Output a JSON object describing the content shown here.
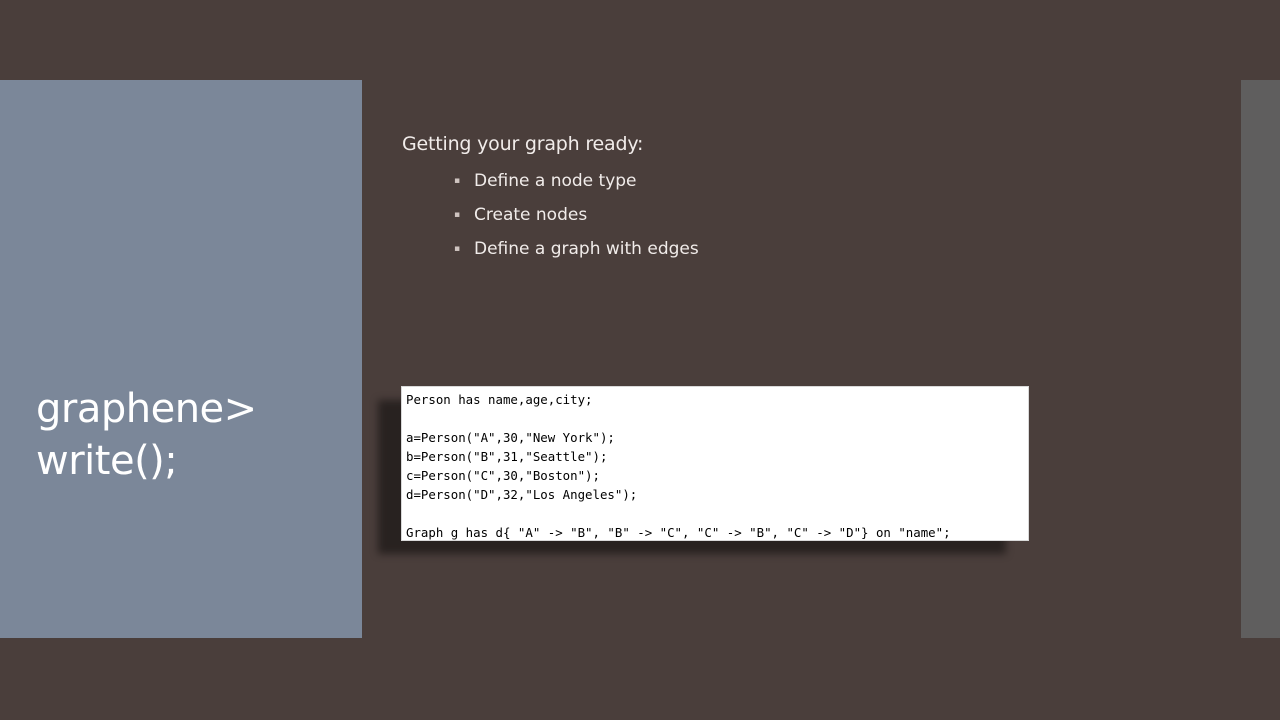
{
  "slide": {
    "title": "graphene>\nwrite();",
    "intro": "Getting your graph ready:",
    "bullets": [
      "Define a node type",
      "Create nodes",
      "Define a graph with edges"
    ],
    "code_lines": [
      "Person has name,age,city;",
      "",
      "a=Person(\"A\",30,\"New York\");",
      "b=Person(\"B\",31,\"Seattle\");",
      "c=Person(\"C\",30,\"Boston\");",
      "d=Person(\"D\",32,\"Los Angeles\");",
      "",
      "Graph g has d{ \"A\" -> \"B\", \"B\" -> \"C\", \"C\" -> \"B\", \"C\" -> \"D\"} on \"name\";"
    ]
  },
  "icons": {
    "bullet": "small-square-bullet-icon"
  },
  "colors": {
    "background": "#4a3e3b",
    "title_panel": "#7b8799",
    "right_edge": "#5f5e5e",
    "text": "#f1ecea"
  }
}
